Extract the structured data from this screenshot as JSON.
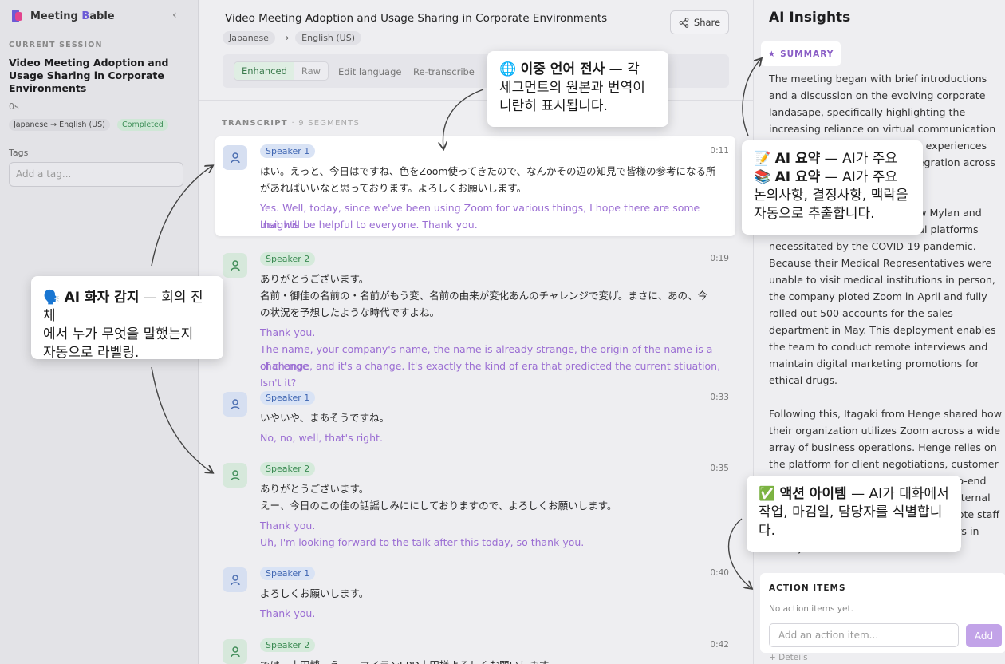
{
  "app": {
    "name": "Meeting Bable",
    "logo_icon": "brand-logo"
  },
  "sidebar": {
    "section_label": "CURRENT SESSION",
    "session_title": "Video Meeting Adoption and Usage Sharing in Corporate Environments",
    "duration": "0s",
    "language_badge": "Japanese → English (US)",
    "status_badge": "Completed",
    "tags_label": "Tags",
    "tag_placeholder": "Add a tag..."
  },
  "main": {
    "title": "Video Meeting Adoption and Usage Sharing in Corporate Environments",
    "source_lang": "Japanese",
    "target_lang": "English (US)",
    "share_label": "Share",
    "toggle": {
      "enhanced": "Enhanced",
      "raw": "Raw"
    },
    "edit_language": "Edit language",
    "retranscribe": "Re-transcribe",
    "transcript_label": "TRANSCRIPT",
    "segment_count": "9 SEGMENTS",
    "segments": [
      {
        "speaker": "Speaker 1",
        "time": "0:11",
        "orig": [
          "はい。えっと、今日はですね、色をZoom使ってきたので、なんかその辺の知見で皆様の参考になる所",
          "があればいいなと思っております。よろしくお願いします。"
        ],
        "trans": [
          "Yes. Well, today, since we've been using Zoom for various things, I hope there are some insights",
          "that will be helpful to everyone. Thank you."
        ]
      },
      {
        "speaker": "Speaker 2",
        "time": "0:19",
        "orig": [
          "ありがとうございます。",
          "名前・御佳の名前の・名前がもう変、名前の由来が変化あんのチャレンジで変げ。まさに、あの、今",
          "の状況を予想したような時代ですよね。"
        ],
        "trans": [
          "Thank you.",
          "The name, your company's name, the name is already strange, the origin of the name is a challenge",
          "of change, and it's a change. It's exactly the kind of era that predicted the current stiuation, Isn't it?"
        ]
      },
      {
        "speaker": "Speaker 1",
        "time": "0:33",
        "orig": [
          "いやいや、まあそうですね。"
        ],
        "trans": [
          "No, no, well, that's right."
        ]
      },
      {
        "speaker": "Speaker 2",
        "time": "0:35",
        "orig": [
          "ありがとうございます。",
          "えー、今日のこの佳の話謡しみににしておりますので、よろしくお願いします。"
        ],
        "trans": [
          "Thank you.",
          "Uh, I'm looking forward to the talk after this today, so thank you."
        ]
      },
      {
        "speaker": "Speaker 1",
        "time": "0:40",
        "orig": [
          "よろしくお願いします。"
        ],
        "trans": [
          "Thank you."
        ]
      },
      {
        "speaker": "Speaker 2",
        "time": "0:42",
        "orig": [
          "では、吉田博、えー、マイランEPD吉田様よろしくお願いします。"
        ],
        "trans": []
      }
    ]
  },
  "insights": {
    "title": "AI Insights",
    "summary_label": "SUMMARY",
    "summary_paragraphs": [
      "The meeting began with brief introductions and a discussion on the evolving corporate landasape, specifically highlighting the increasing reliance on virtual communication tools. Participants shared their experiences and challenges with Zoom integration across business functions.",
      "Representatives discussed how Mylan and their recent transition to virtual platforms necessitated by the COVID-19 pandemic. Because their Medical Representatives were unable to visit medical institutions in person, the company ploted Zoom in April and fully rolled out 500 accounts for the sales department in May. This deployment enables the team to conduct remote interviews and maintain digital marketing promotions for ethical drugs.",
      "Following this, Itagaki from Henge shared how their organization utilizes Zoom across a wide array of business operations. Henge relies on the platform for client negotiations, customer support, internal meetings, and end-to-end hiring. Itagaki noted that even their internal seminars are held on Zoom, with remote staff joining from outside their headquarters in Shibuya."
    ],
    "action_title": "ACTION ITEMS",
    "action_empty": "No action items yet.",
    "action_placeholder": "Add an action item...",
    "add_label": "Add",
    "details_label": "+ Deteils"
  },
  "callouts": {
    "bilingual": {
      "emoji": "🌐",
      "title": "이중 언어 전사",
      "dash": " — 각",
      "line2": "세그먼트의 원본과 번역이",
      "line3": "니란히 표시됩니다."
    },
    "speaker": {
      "emoji": "🗣️",
      "title": "AI 화자 감지",
      "dash": " — 회의 진체",
      "line2": "에서 누가 무엇을 말했는지",
      "line3": "자동으로 라벨링."
    },
    "summary": {
      "emoji1": "📝",
      "emoji2": "📚",
      "title": "AI 요약",
      "dash": " — AI가 주요",
      "line3": "논의사항, 결정사항, 맥락을",
      "line4": "자동으로 추출합니다."
    },
    "action": {
      "emoji": "✅",
      "title": "액션 아이템",
      "dash": " — AI가 대화에서",
      "line2": "작업, 마김일, 담당자를 식별합니",
      "line3": "다."
    }
  },
  "colors": {
    "accent_purple": "#9b6ed3",
    "speaker1_blue": "#3f66b2",
    "speaker2_green": "#3a8a52",
    "add_button": "#c2a3e8"
  }
}
